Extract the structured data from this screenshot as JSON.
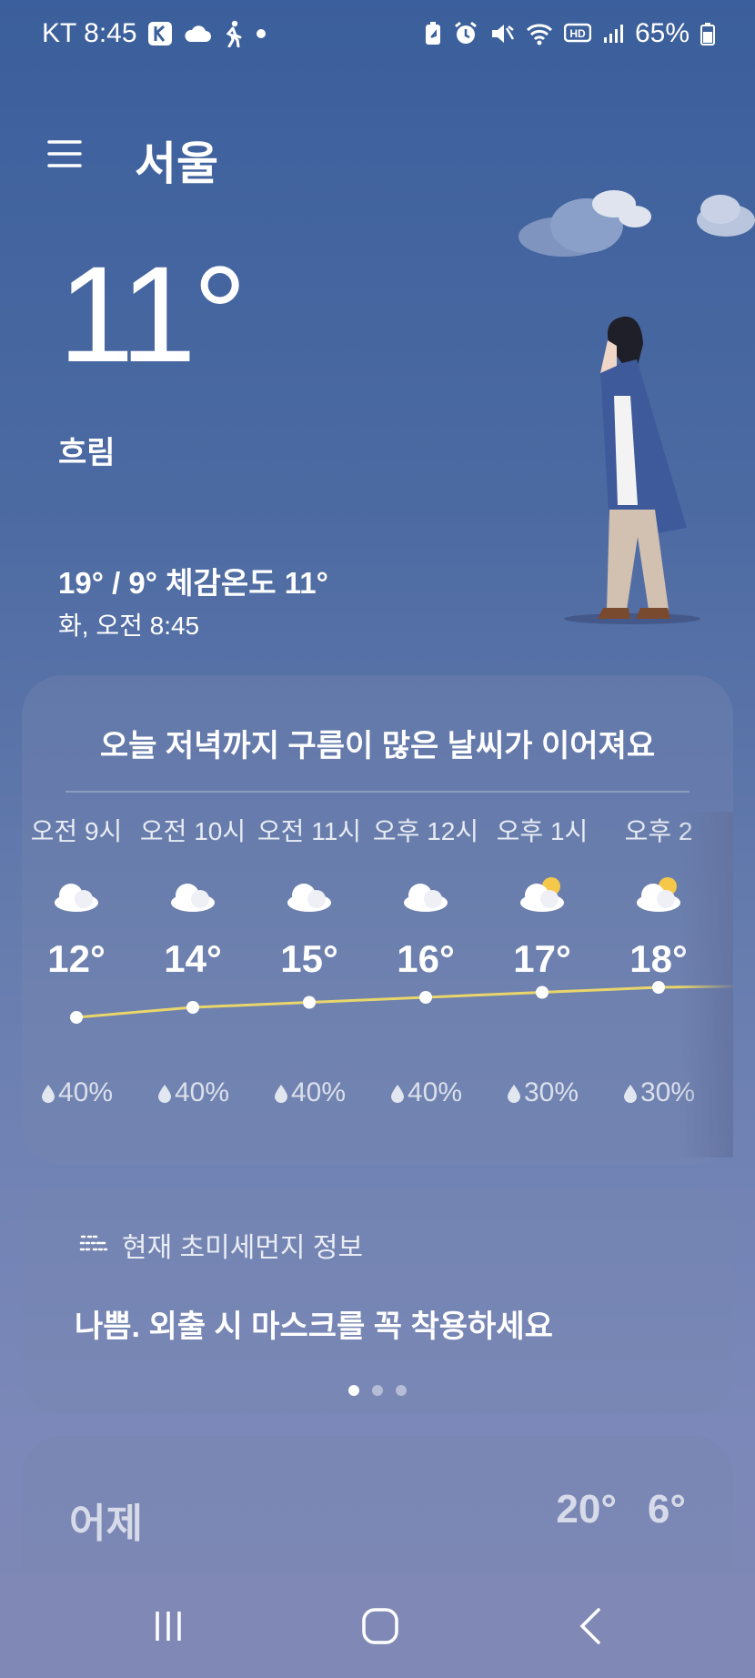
{
  "status_bar": {
    "carrier_time": "KT 8:45",
    "battery": "65%"
  },
  "header": {
    "city": "서울"
  },
  "current": {
    "temperature": "11°",
    "condition": "흐림",
    "hi_lo_feels": "19° / 9° 체감온도 11°",
    "datetime": "화, 오전 8:45"
  },
  "forecast": {
    "summary": "오늘 저녁까지 구름이 많은 날씨가 이어져요",
    "hours": [
      {
        "time": "오전 9시",
        "temp": "12°",
        "precip": "40%",
        "icon": "cloud-icon",
        "t": 12
      },
      {
        "time": "오전 10시",
        "temp": "14°",
        "precip": "40%",
        "icon": "cloud-icon",
        "t": 14
      },
      {
        "time": "오전 11시",
        "temp": "15°",
        "precip": "40%",
        "icon": "cloud-icon",
        "t": 15
      },
      {
        "time": "오후 12시",
        "temp": "16°",
        "precip": "40%",
        "icon": "cloud-icon",
        "t": 16
      },
      {
        "time": "오후 1시",
        "temp": "17°",
        "precip": "30%",
        "icon": "partly-sunny-icon",
        "t": 17
      },
      {
        "time": "오후 2",
        "temp": "18°",
        "precip": "30%",
        "icon": "partly-sunny-icon",
        "t": 18
      }
    ]
  },
  "dust": {
    "title": "현재 초미세먼지 정보",
    "message": "나쁨. 외출 시 마스크를 꼭 착용하세요"
  },
  "yesterday": {
    "label": "어제",
    "high": "20°",
    "low": "6°"
  },
  "colors": {
    "accent_line": "#e9d66b",
    "sun": "#f5c84a"
  }
}
